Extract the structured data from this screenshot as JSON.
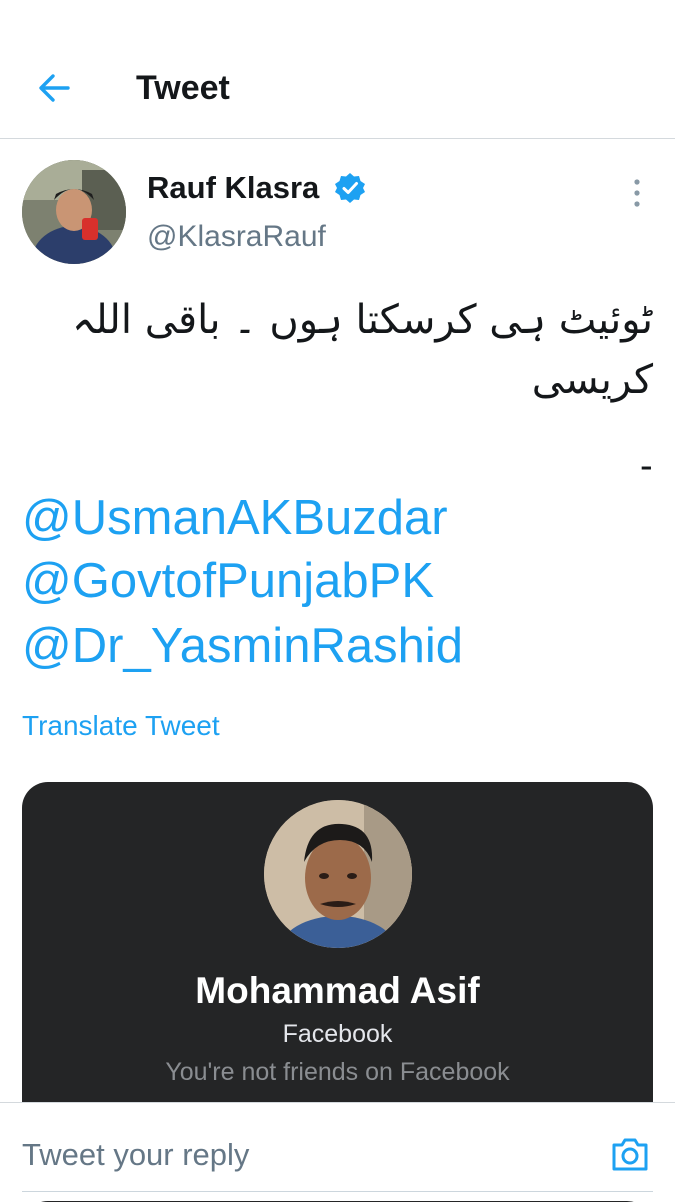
{
  "header": {
    "title": "Tweet",
    "back_icon": "arrow-left-icon"
  },
  "tweet": {
    "author": {
      "name": "Rauf Klasra",
      "handle": "@KlasraRauf",
      "verified": true
    },
    "text_line1": "ٹوئیٹ ہی کرسکتا ہوں ۔ باقی اللہ",
    "text_line2": "کریسی",
    "text_line3": "-",
    "mentions": [
      "@UsmanAKBuzdar",
      "@GovtofPunjabPK",
      "@Dr_YasminRashid"
    ],
    "translate_label": "Translate Tweet",
    "embedded_card": {
      "name": "Mohammad Asif",
      "source": "Facebook",
      "status": "You're not friends on Facebook"
    }
  },
  "reply": {
    "placeholder": "Tweet your reply",
    "camera_icon": "camera-icon"
  },
  "colors": {
    "accent": "#1da1f2",
    "card_bg": "#242526",
    "text": "#14171a",
    "muted": "#657786"
  }
}
